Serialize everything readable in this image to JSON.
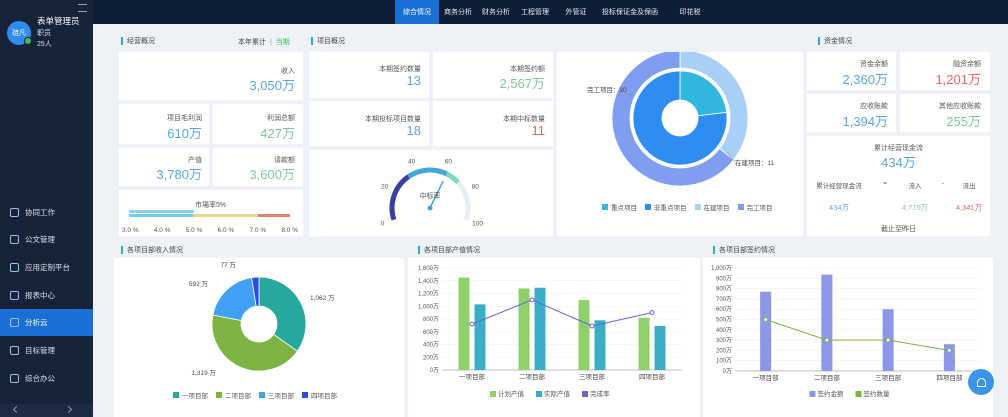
{
  "sidebar": {
    "avatar": "琏凡",
    "org": "表单管理员",
    "role": "职员",
    "count": "25人",
    "menu": [
      {
        "label": "协同工作",
        "icon": "share-icon"
      },
      {
        "label": "公文管理",
        "icon": "user-icon"
      },
      {
        "label": "应用定制平台",
        "icon": "cube-icon"
      },
      {
        "label": "报表中心",
        "icon": "report-icon"
      },
      {
        "label": "分析云",
        "icon": "monitor-icon"
      },
      {
        "label": "目标管理",
        "icon": "target-icon"
      },
      {
        "label": "综合办公",
        "icon": "calendar-icon"
      }
    ],
    "active_index": 4
  },
  "topnav": {
    "tabs": [
      "综合情况",
      "商务分析",
      "财务分析",
      "工程管理",
      "外管证",
      "投标保证金及保函",
      "印花税"
    ],
    "active": 0
  },
  "business": {
    "title": "经营概况",
    "toggle_a": "本年累计",
    "toggle_sep": "|",
    "toggle_b": "当期",
    "income_label": "收入",
    "income": "3,050万",
    "gross_profit_label": "项目毛利润",
    "gross_profit": "610万",
    "profit_label": "利润总额",
    "profit": "427万",
    "output_label": "产值",
    "output": "3,780万",
    "claim_label": "请款额",
    "claim": "3,600万",
    "market_label": "市場率5%",
    "market_ticks": [
      "3.0 %",
      "4.0 %",
      "5.0 %",
      "6.0 %",
      "7.0 %",
      "8.0 %"
    ],
    "market_value": 5.0
  },
  "project": {
    "title": "项目概况",
    "signed_count_label": "本期签约数量",
    "signed_count": "13",
    "signed_amount_label": "本期签约额",
    "signed_amount": "2,567万",
    "bid_count_label": "本期投标项目数量",
    "bid_count": "18",
    "win_count_label": "本期中标数量",
    "win_count": "11",
    "gauge_label": "中标率",
    "gauge_value": 62,
    "gauge_ticks": [
      "0",
      "20",
      "40",
      "60",
      "80",
      "100"
    ],
    "donut_labels": {
      "done": "完工项目：20",
      "ongoing": "在建项目：11"
    },
    "donut": [
      {
        "name": "重点项目",
        "value": 6,
        "color": "#2fb7e0"
      },
      {
        "name": "非重点项目",
        "value": 20,
        "color": "#2f8cf0"
      },
      {
        "name": "在建项目",
        "value": 11,
        "color": "#a8cff5"
      },
      {
        "name": "完工项目",
        "value": 20,
        "color": "#7f9ef0"
      }
    ]
  },
  "funds": {
    "title": "资金情况",
    "balance_label": "资金余额",
    "balance": "2,360万",
    "loan_label": "融资余额",
    "loan": "1,201万",
    "receivable_label": "应收账款",
    "receivable": "1,394万",
    "other_label": "其他应收账款",
    "other": "255万",
    "cashflow_label": "累计经营现金流",
    "cashflow": "434万",
    "formula": [
      "累计经营现金流",
      "=",
      "流入",
      "-",
      "流出"
    ],
    "formula_vals": [
      "434万",
      "4,775万",
      "4,341万"
    ],
    "cutoff": "截止至昨日"
  },
  "income_chart": {
    "title": "各项目部收入情况",
    "labels": [
      "77 万",
      "1,062 万",
      "1,319 万",
      "592 万"
    ],
    "legend": [
      "一项目部",
      "二项目部",
      "三项目部",
      "四项目部"
    ],
    "colors": [
      "#27a89c",
      "#7cb342",
      "#3fa0f5",
      "#2b4de0"
    ]
  },
  "chart_data": [
    {
      "type": "pie",
      "title": "各项目部收入情况",
      "categories": [
        "一项目部",
        "二项目部",
        "三项目部",
        "四项目部"
      ],
      "values": [
        1062,
        1319,
        592,
        77
      ]
    },
    {
      "type": "bar",
      "title": "各项目部产值情况",
      "categories": [
        "一项目部",
        "二项目部",
        "三项目部",
        "四项目部"
      ],
      "ylim": [
        0,
        1600
      ],
      "yticks": [
        "0万",
        "200万",
        "400万",
        "600万",
        "800万",
        "1,000万",
        "1,200万",
        "1,400万",
        "1,600万"
      ],
      "series": [
        {
          "name": "计划产值",
          "kind": "bar",
          "color": "#8fd06a",
          "values": [
            1450,
            1280,
            1100,
            820
          ]
        },
        {
          "name": "实际产值",
          "kind": "bar",
          "color": "#3aaec4",
          "values": [
            1030,
            1290,
            780,
            690
          ]
        },
        {
          "name": "完成率",
          "kind": "line",
          "color": "#6f63d8",
          "values": [
            720,
            1100,
            690,
            900
          ]
        }
      ]
    },
    {
      "type": "bar",
      "title": "各项目部签约情况",
      "categories": [
        "一项目部",
        "二项目部",
        "三项目部",
        "四项目部"
      ],
      "ylim": [
        0,
        1000
      ],
      "yticks": [
        "0万",
        "100万",
        "200万",
        "300万",
        "400万",
        "500万",
        "600万",
        "700万",
        "800万",
        "900万",
        "1,000万"
      ],
      "series": [
        {
          "name": "签约金额",
          "kind": "bar",
          "color": "#8c97e8",
          "values": [
            770,
            935,
            600,
            260
          ]
        },
        {
          "name": "签约数量",
          "kind": "line",
          "color": "#7cb342",
          "values": [
            500,
            300,
            300,
            200
          ]
        }
      ]
    }
  ],
  "output_chart": {
    "title": "各项目部产值情况"
  },
  "sign_chart": {
    "title": "各项目部签约情况"
  }
}
